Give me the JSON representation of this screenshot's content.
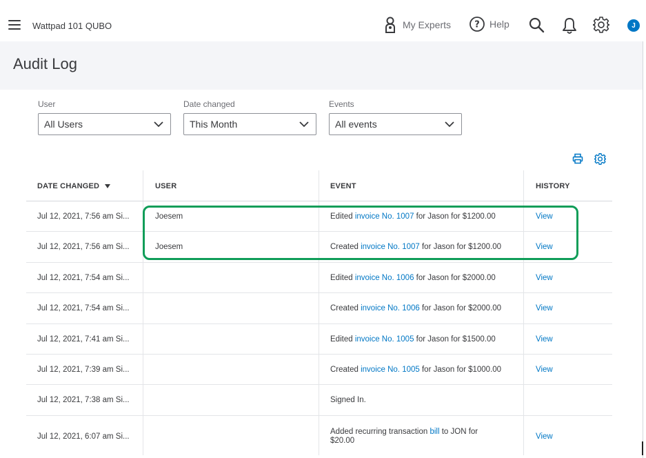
{
  "topbar": {
    "company_name": "Wattpad 101 QUBO",
    "my_experts_label": "My Experts",
    "help_label": "Help",
    "avatar_initial": "J"
  },
  "page": {
    "title": "Audit Log"
  },
  "filters": {
    "user": {
      "label": "User",
      "value": "All Users"
    },
    "date_changed": {
      "label": "Date changed",
      "value": "This Month"
    },
    "events": {
      "label": "Events",
      "value": "All events"
    }
  },
  "table": {
    "headers": {
      "date_changed": "DATE CHANGED",
      "user": "USER",
      "event": "EVENT",
      "history": "HISTORY"
    },
    "rows": [
      {
        "date": "Jul 12, 2021, 7:56 am Si...",
        "user": "Joesem",
        "event_pre": "Edited ",
        "event_link": "invoice No. 1007",
        "event_post": " for Jason for $1200.00",
        "history": "View"
      },
      {
        "date": "Jul 12, 2021, 7:56 am Si...",
        "user": "Joesem",
        "event_pre": "Created ",
        "event_link": "invoice No. 1007",
        "event_post": " for Jason for $1200.00",
        "history": "View"
      },
      {
        "date": "Jul 12, 2021, 7:54 am Si...",
        "user": "",
        "event_pre": "Edited ",
        "event_link": "invoice No. 1006",
        "event_post": " for Jason for $2000.00",
        "history": "View"
      },
      {
        "date": "Jul 12, 2021, 7:54 am Si...",
        "user": "",
        "event_pre": "Created ",
        "event_link": "invoice No. 1006",
        "event_post": " for Jason for $2000.00",
        "history": "View"
      },
      {
        "date": "Jul 12, 2021, 7:41 am Si...",
        "user": "",
        "event_pre": "Edited ",
        "event_link": "invoice No. 1005",
        "event_post": " for Jason for $1500.00",
        "history": "View"
      },
      {
        "date": "Jul 12, 2021, 7:39 am Si...",
        "user": "",
        "event_pre": "Created ",
        "event_link": "invoice No. 1005",
        "event_post": " for Jason for $1000.00",
        "history": "View"
      },
      {
        "date": "Jul 12, 2021, 7:38 am Si...",
        "user": "",
        "event_pre": "Signed In.",
        "event_link": "",
        "event_post": "",
        "history": ""
      },
      {
        "date": "Jul 12, 2021, 6:07 am Si...",
        "user": "",
        "event_pre": "Added recurring transaction ",
        "event_link": "bill",
        "event_post": " to JON for $20.00",
        "history": "View"
      }
    ]
  },
  "colors": {
    "link": "#0077c5",
    "highlight": "#0f9d58",
    "header_bg": "#f4f5f8"
  }
}
